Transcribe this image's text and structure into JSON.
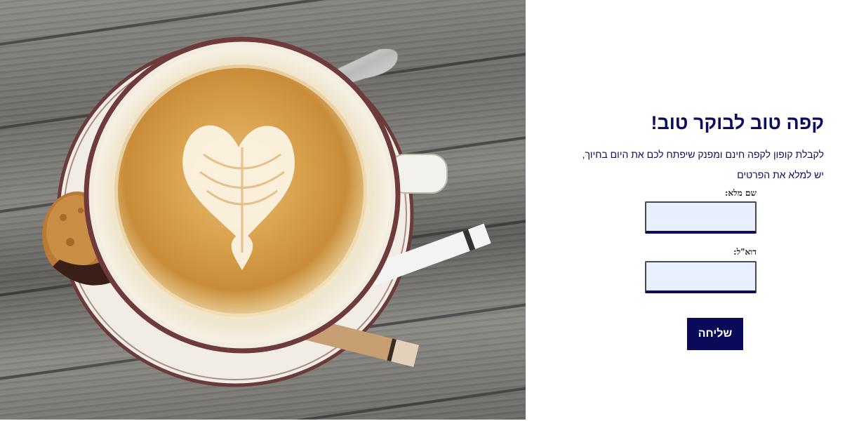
{
  "hero_image": {
    "subject": "coffee cup with heart latte art on wooden table"
  },
  "form": {
    "title": "קפה טוב לבוקר טוב!",
    "intro_line1": "לקבלת קופון לקפה חינם ומפנק שיפתח לכם את היום בחיוך,",
    "intro_line2": "יש למלא את הפרטים",
    "name_label": "שם מלא:",
    "name_value": "",
    "email_label": "דוא\"ל:",
    "email_value": "",
    "submit_label": "שליחה"
  },
  "colors": {
    "accent": "#0d0d5e",
    "button": "#0a0a5a",
    "field_bg": "#e8efff"
  }
}
